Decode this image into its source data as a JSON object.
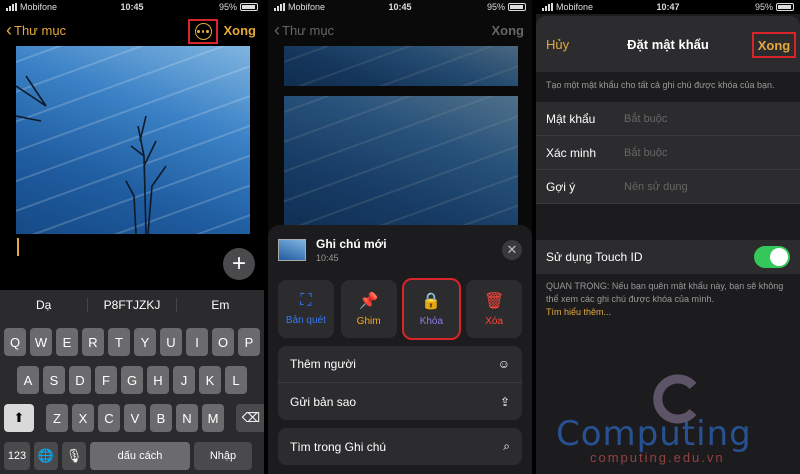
{
  "status": {
    "carrier": "Mobifone",
    "battery": "95%",
    "time1": "10:45",
    "time2": "10:45",
    "time3": "10:47"
  },
  "p1": {
    "back_label": "Thư mục",
    "done_label": "Xong",
    "suggestions": [
      "Dạ",
      "P8FTJZKJ",
      "Em"
    ],
    "row1": [
      "Q",
      "W",
      "E",
      "R",
      "T",
      "Y",
      "U",
      "I",
      "O",
      "P"
    ],
    "row2": [
      "A",
      "S",
      "D",
      "F",
      "G",
      "H",
      "J",
      "K",
      "L"
    ],
    "row3": [
      "Z",
      "X",
      "C",
      "V",
      "B",
      "N",
      "M"
    ],
    "key_123": "123",
    "space": "dấu cách",
    "enter": "Nhập",
    "accent": "#e5a83a"
  },
  "p2": {
    "back_label": "Thư mục",
    "done_label": "Xong",
    "note_title": "Ghi chú mới",
    "note_time": "10:45",
    "actions": [
      {
        "label": "Bản quét",
        "icon": "scan-icon",
        "color": "#3478f6"
      },
      {
        "label": "Ghim",
        "icon": "pin-icon",
        "color": "#f5a623"
      },
      {
        "label": "Khóa",
        "icon": "lock-icon",
        "color": "#8e7cf0"
      },
      {
        "label": "Xóa",
        "icon": "trash-icon",
        "color": "#ff453a"
      }
    ],
    "rows": [
      {
        "label": "Thêm người",
        "icon": "add-person-icon"
      },
      {
        "label": "Gửi bản sao",
        "icon": "share-icon"
      }
    ],
    "find_label": "Tìm trong Ghi chú"
  },
  "p3": {
    "cancel": "Hủy",
    "title": "Đặt mật khẩu",
    "done": "Xong",
    "description": "Tạo một mật khẩu cho tất cả ghi chú được khóa của bạn.",
    "fields": [
      {
        "label": "Mật khẩu",
        "placeholder": "Bắt buộc"
      },
      {
        "label": "Xác minh",
        "placeholder": "Bắt buộc"
      },
      {
        "label": "Gợi ý",
        "placeholder": "Nên sử dụng"
      }
    ],
    "touch_id_label": "Sử dụng Touch ID",
    "touch_id_on": true,
    "warning": "QUAN TRỌNG: Nếu bạn quên mật khẩu này, bạn sẽ không thể xem các ghi chú được khóa của mình.",
    "learn_more": "Tìm hiểu thêm..."
  },
  "watermark": {
    "brand": "Computing",
    "url": "computing.edu.vn"
  }
}
